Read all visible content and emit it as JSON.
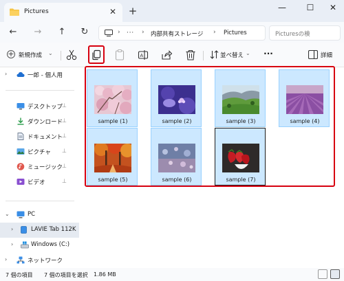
{
  "window": {
    "tab_title": "Pictures",
    "tab_close_glyph": "✕",
    "new_tab_glyph": "+",
    "minimize_glyph": "—",
    "maximize_glyph": "☐",
    "close_glyph": "✕"
  },
  "address": {
    "back_glyph": "←",
    "forward_glyph": "→",
    "up_glyph": "↑",
    "refresh_glyph": "↻",
    "ellipsis": "···",
    "crumbs": [
      "内部共有ストレージ",
      "Pictures"
    ],
    "separator": "›",
    "search_placeholder": "Picturesの検"
  },
  "commandbar": {
    "new_label": "新規作成",
    "sort_label": "並べ替え",
    "more_label": "···",
    "details_label": "詳細",
    "chevron": "⌄"
  },
  "nav": {
    "cloud_item": "一郎 - 個人用",
    "quick_access": [
      {
        "label": "デスクトップ",
        "icon": "desktop-icon"
      },
      {
        "label": "ダウンロード",
        "icon": "download-icon"
      },
      {
        "label": "ドキュメント",
        "icon": "document-icon"
      },
      {
        "label": "ピクチャ",
        "icon": "pictures-icon"
      },
      {
        "label": "ミュージック",
        "icon": "music-icon"
      },
      {
        "label": "ビデオ",
        "icon": "video-icon"
      }
    ],
    "pin_glyph": "📌",
    "pc_label": "PC",
    "device_label": "LAVIE Tab 112K",
    "windows_label": "Windows (C:)",
    "network_label": "ネットワーク",
    "expand_glyph": "›",
    "collapse_glyph": "⌄"
  },
  "files": [
    {
      "name": "sample (1)",
      "theme": "cherry-blossom"
    },
    {
      "name": "sample (2)",
      "theme": "purple-flower"
    },
    {
      "name": "sample (3)",
      "theme": "green-hills"
    },
    {
      "name": "sample (4)",
      "theme": "lavender-field"
    },
    {
      "name": "sample (5)",
      "theme": "autumn-forest"
    },
    {
      "name": "sample (6)",
      "theme": "bokeh-lights"
    },
    {
      "name": "sample (7)",
      "theme": "strawberries"
    }
  ],
  "status": {
    "item_count": "7 個の項目",
    "selected": "7 個の項目を選択",
    "size": "1.86 MB"
  },
  "colors": {
    "selection_fill": "#cce8ff",
    "selection_border": "#99d1ff",
    "callout_red": "#d7000f",
    "folder_yellow": "#f6c443"
  }
}
